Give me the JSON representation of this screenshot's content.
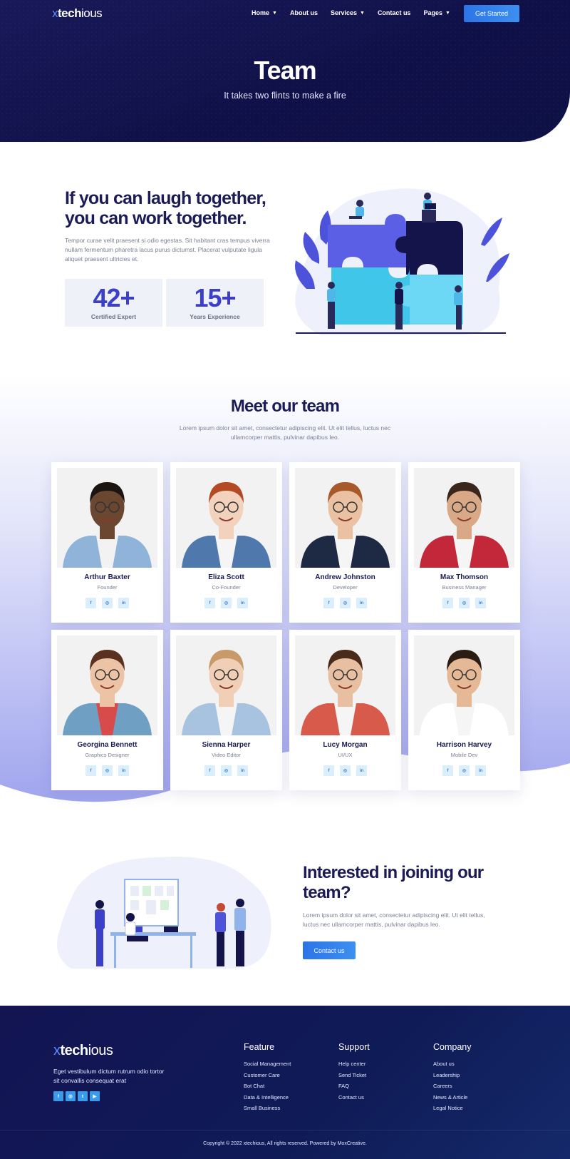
{
  "header": {
    "logo": {
      "x": "x",
      "bold": "tech",
      "light": "ious"
    },
    "nav": [
      {
        "label": "Home",
        "dropdown": true
      },
      {
        "label": "About us",
        "dropdown": false
      },
      {
        "label": "Services",
        "dropdown": true
      },
      {
        "label": "Contact us",
        "dropdown": false
      },
      {
        "label": "Pages",
        "dropdown": true
      }
    ],
    "cta_label": "Get Started"
  },
  "hero": {
    "title": "Team",
    "subtitle": "It takes two flints to make a fire"
  },
  "about": {
    "heading": "If you can laugh together, you can work together.",
    "text": "Tempor curae velit praesent si odio egestas. Sit habitant cras tempus viverra nullam fermentum pharetra lacus purus dictumst. Placerat vulputate ligula aliquet praesent ultricies et.",
    "stats": [
      {
        "value": "42+",
        "label": "Certified Expert"
      },
      {
        "value": "15+",
        "label": "Years Experience"
      }
    ]
  },
  "team": {
    "title": "Meet our team",
    "description": "Lorem ipsum dolor sit amet, consectetur adipiscing elit. Ut elit tellus, luctus nec ullamcorper mattis, pulvinar dapibus leo.",
    "members": [
      {
        "name": "Arthur Baxter",
        "role": "Founder"
      },
      {
        "name": "Eliza Scott",
        "role": "Co-Founder"
      },
      {
        "name": "Andrew Johnston",
        "role": "Developer"
      },
      {
        "name": "Max Thomson",
        "role": "Business Manager"
      },
      {
        "name": "Georgina Bennett",
        "role": "Graphics Designer"
      },
      {
        "name": "Sienna Harper",
        "role": "Video Editor"
      },
      {
        "name": "Lucy Morgan",
        "role": "UI/UX"
      },
      {
        "name": "Harrison Harvey",
        "role": "Mobile Dev"
      }
    ],
    "social_icons": [
      "facebook-icon",
      "instagram-icon",
      "linkedin-icon"
    ]
  },
  "join": {
    "heading": "Interested in joining our team?",
    "text": "Lorem ipsum dolor sit amet, consectetur adipiscing elit. Ut elit tellus, luctus nec ullamcorper mattis, pulvinar dapibus leo.",
    "button_label": "Contact us"
  },
  "footer": {
    "logo": {
      "x": "x",
      "bold": "tech",
      "light": "ious"
    },
    "description": "Eget vestibulum dictum rutrum odio tortor sit convallis consequat erat",
    "social_icons": [
      "facebook-icon",
      "instagram-icon",
      "twitter-icon",
      "youtube-icon"
    ],
    "columns": [
      {
        "title": "Feature",
        "links": [
          "Social Management",
          "Customer Care",
          "Bot Chat",
          "Data & Intelligence",
          "Small Business"
        ]
      },
      {
        "title": "Support",
        "links": [
          "Help center",
          "Send Ticket",
          "FAQ",
          "Contact us"
        ]
      },
      {
        "title": "Company",
        "links": [
          "About us",
          "Leadership",
          "Careers",
          "News & Article",
          "Legal Notice"
        ]
      }
    ],
    "copyright": "Copyright © 2022 xtechious, All rights reserved. Powered by MoxCreative."
  },
  "colors": {
    "navy": "#101048",
    "accent": "#3c3fc7",
    "button": "#2c74e6",
    "lavender": "#a9acef"
  }
}
